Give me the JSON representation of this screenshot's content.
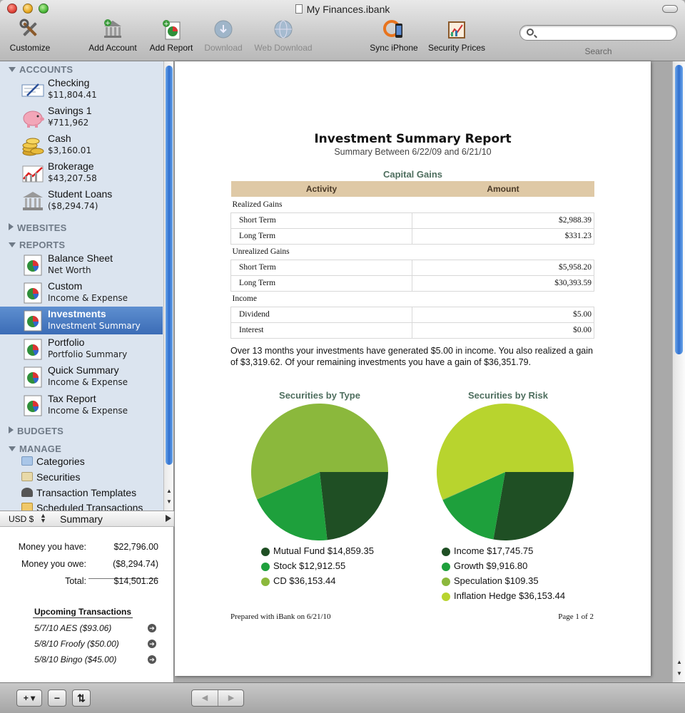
{
  "window": {
    "title": "My Finances.ibank"
  },
  "toolbar": {
    "customize": "Customize",
    "add_account": "Add Account",
    "add_report": "Add Report",
    "download": "Download",
    "web_download": "Web Download",
    "sync_iphone": "Sync iPhone",
    "security_prices": "Security Prices",
    "search_placeholder": "",
    "search_label": "Search"
  },
  "sidebar": {
    "accounts_header": "ACCOUNTS",
    "accounts": [
      {
        "name": "Checking",
        "amount": "$11,804.41",
        "icon": "checkbook-icon"
      },
      {
        "name": "Savings 1",
        "amount": "¥711,962",
        "icon": "piggy-bank-icon"
      },
      {
        "name": "Cash",
        "amount": "$3,160.01",
        "icon": "coins-icon"
      },
      {
        "name": "Brokerage",
        "amount": "$43,207.58",
        "icon": "stock-chart-icon"
      },
      {
        "name": "Student Loans",
        "amount": "($8,294.74)",
        "icon": "bank-building-icon"
      }
    ],
    "websites_header": "WEBSITES",
    "reports_header": "REPORTS",
    "reports": [
      {
        "name": "Balance Sheet",
        "sub": "Net Worth"
      },
      {
        "name": "Custom",
        "sub": "Income & Expense"
      },
      {
        "name": "Investments",
        "sub": "Investment Summary"
      },
      {
        "name": "Portfolio",
        "sub": "Portfolio Summary"
      },
      {
        "name": "Quick Summary",
        "sub": "Income & Expense"
      },
      {
        "name": "Tax Report",
        "sub": "Income & Expense"
      }
    ],
    "budgets_header": "BUDGETS",
    "manage_header": "MANAGE",
    "manage": [
      "Categories",
      "Securities",
      "Transaction Templates",
      "Scheduled Transactions"
    ]
  },
  "summary": {
    "currency": "USD $",
    "title": "Summary",
    "have_label": "Money you have:",
    "have_value": "$22,796.00",
    "owe_label": "Money you owe:",
    "owe_value": "($8,294.74)",
    "total_label": "Total:",
    "total_value": "$14,501.26",
    "upcoming_title": "Upcoming Transactions",
    "upcoming": [
      "5/7/10 AES ($93.06)",
      "5/8/10 Froofy ($50.00)",
      "5/8/10 Bingo ($45.00)"
    ]
  },
  "bottom": {
    "add": "+ ▾",
    "remove": "−",
    "sync": "⇅"
  },
  "report": {
    "title": "Investment Summary Report",
    "subtitle": "Summary Between 6/22/09 and 6/21/10",
    "capital_gains_title": "Capital Gains",
    "col_activity": "Activity",
    "col_amount": "Amount",
    "sections": [
      {
        "name": "Realized Gains",
        "rows": [
          {
            "label": "Short Term",
            "amount": "$2,988.39"
          },
          {
            "label": "Long Term",
            "amount": "$331.23"
          }
        ]
      },
      {
        "name": "Unrealized Gains",
        "rows": [
          {
            "label": "Short Term",
            "amount": "$5,958.20"
          },
          {
            "label": "Long Term",
            "amount": "$30,393.59"
          }
        ]
      },
      {
        "name": "Income",
        "rows": [
          {
            "label": "Dividend",
            "amount": "$5.00"
          },
          {
            "label": "Interest",
            "amount": "$0.00"
          }
        ]
      }
    ],
    "paragraph": "Over 13 months your investments have generated $5.00 in income.  You also realized a gain of $3,319.62.  Of your remaining investments you have a gain of $36,351.79.",
    "footer_left": "Prepared with iBank on 6/21/10",
    "footer_right": "Page 1 of 2"
  },
  "chart_data": [
    {
      "type": "pie",
      "title": "Securities by Type",
      "labels": [
        "Mutual Fund",
        "Stock",
        "CD"
      ],
      "values": [
        14859.35,
        12912.55,
        36153.44
      ],
      "legend": [
        "Mutual Fund $14,859.35",
        "Stock $12,912.55",
        "CD $36,153.44"
      ],
      "colors": [
        "#1f4f24",
        "#1ea03c",
        "#8bb83c"
      ]
    },
    {
      "type": "pie",
      "title": "Securities by Risk",
      "labels": [
        "Income",
        "Growth",
        "Speculation",
        "Inflation Hedge"
      ],
      "values": [
        17745.75,
        9916.8,
        109.35,
        36153.44
      ],
      "legend": [
        "Income $17,745.75",
        "Growth $9,916.80",
        "Speculation $109.35",
        "Inflation Hedge $36,153.44"
      ],
      "colors": [
        "#1f4f24",
        "#1ea03c",
        "#8bb83c",
        "#b8d42e"
      ]
    }
  ]
}
